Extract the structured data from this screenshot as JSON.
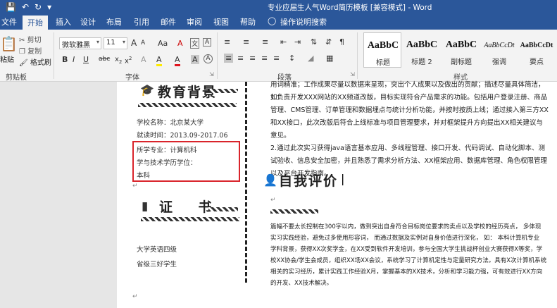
{
  "titlebar": {
    "title": "专业应届生人气Word简历模板 [兼容模式] - Word",
    "save_icon": "save-icon",
    "undo_icon": "undo-icon",
    "redo_icon": "redo-icon",
    "customize_icon": "customize-icon"
  },
  "tabs": [
    "文件",
    "开始",
    "插入",
    "设计",
    "布局",
    "引用",
    "邮件",
    "审阅",
    "视图",
    "帮助",
    "操作说明搜索"
  ],
  "active_tab": "开始",
  "clipboard": {
    "paste": "粘贴",
    "cut": "剪切",
    "copy": "复制",
    "format_painter": "格式刷",
    "label": "剪贴板"
  },
  "font": {
    "family": "微软雅黑",
    "size": "11",
    "label": "字体",
    "grow": "A",
    "shrink": "A",
    "aa": "Aa",
    "clear": "A",
    "wen": "文",
    "bold": "B",
    "italic": "I",
    "underline": "U",
    "strike": "abc",
    "sub": "x",
    "sup": "x",
    "effects": "A",
    "highlight": "A",
    "fontcolor": "A",
    "shade": "A",
    "border": "A"
  },
  "paragraph": {
    "label": "段落"
  },
  "styles": {
    "label": "样式",
    "items": [
      {
        "sample": "AaBbC",
        "name": "标题"
      },
      {
        "sample": "AaBbC",
        "name": "标题 2"
      },
      {
        "sample": "AaBbC",
        "name": "副标题"
      },
      {
        "sample": "AaBbCcDt",
        "name": "强调"
      },
      {
        "sample": "AaBbCcDt",
        "name": "要点"
      }
    ]
  },
  "document": {
    "left": {
      "education_title": "教育背景",
      "school": "学校名称：北京某大学",
      "period": "就读时间：2013.09-2017.06",
      "major": "所学专业：计算机科",
      "degree_line": "学与技术学历学位：",
      "degree": "本科",
      "cert_title": "证    书",
      "cert1": "大学英语四级",
      "cert2": "省级三好学生"
    },
    "right": {
      "lines_top": [
        "用词精准；工作成果尽量以数据来呈现，突出个人成果以及做出的贡献；描述尽量具体简洁，如：",
        "1.负责开发XXX网站的XX频道改版，目标实现符合产品需求的功能。包括用户登录注册、商品",
        "管理、CMS管理、订单管理和数据埋点与统计分析功能，并按时按质上线；通过接入第三方XX",
        "和XX接口，此次改版后符合上线标准与项目管理要求，并对框架提升方向提出XX相关建议与",
        "意见。",
        "2.通过此次实习获得java语言基本应用、多线程管理、接口开发、代码调试、自动化脚本、测",
        "试验收、信息安全加密，并且熟悉了需求分析方法、XX框架应用、数据库管理、角色权限管理",
        "以及平台开发指南。"
      ],
      "eval_title": "自我评价",
      "lines_eval": [
        "篇幅不要太长控制在300字以内，做到突出自身符合目标岗位要求的卖点以及学校的经历亮点，  多体现",
        "实习实践经验，避免过多使用形容词，  而通过数据及实例对自身价值进行深化，  如：  本科计算机专业",
        "学科背景，获得XX次奖学金，在XX受到软件开发培训，参与全国大学生挑战杯创业大赛获得X等奖，学",
        "校XX协会/学生会成员，组织XX场XX会议，系统学习了计算机定性与定量研究方法。具有X次计算机系统",
        "相关的实习经历，累计实践工作经验X月，掌握基本的XX技术，分析和学习能力强，可有效进行XX方向",
        "的开发、XX技术解决。"
      ]
    }
  }
}
